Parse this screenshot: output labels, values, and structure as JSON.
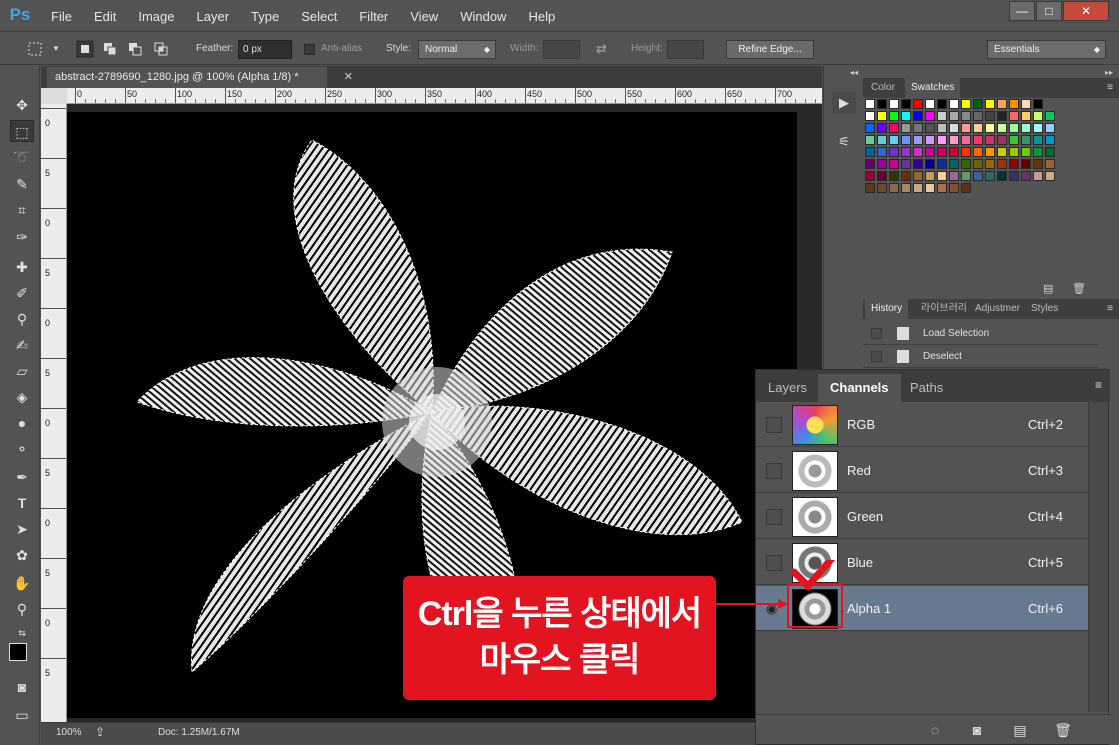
{
  "app": {
    "logo": "Ps"
  },
  "menu": [
    "File",
    "Edit",
    "Image",
    "Layer",
    "Type",
    "Select",
    "Filter",
    "View",
    "Window",
    "Help"
  ],
  "window_controls": {
    "minimize": "—",
    "maximize": "□",
    "close": "✕"
  },
  "options": {
    "feather_label": "Feather:",
    "feather_value": "0 px",
    "antialias_label": "Anti-alias",
    "style_label": "Style:",
    "style_value": "Normal",
    "width_label": "Width:",
    "height_label": "Height:",
    "refine_button": "Refine Edge...",
    "workspace_value": "Essentials"
  },
  "document": {
    "tab_title": "abstract-2789690_1280.jpg @ 100% (Alpha 1/8) *",
    "close_glyph": "✕",
    "ruler_top_labels": [
      "0",
      "50",
      "100",
      "150",
      "200",
      "250",
      "300",
      "350",
      "400",
      "450",
      "500",
      "550",
      "600",
      "650",
      "700"
    ],
    "ruler_left_labels": [
      "0",
      "5",
      "0",
      "5",
      "0",
      "5",
      "0",
      "5",
      "0",
      "5",
      "0",
      "5"
    ],
    "zoom": "100%",
    "doc_info": "Doc: 1.25M/1.67M"
  },
  "swatches_panel": {
    "tabs": [
      "Color",
      "Swatches"
    ],
    "active_tab": "Swatches",
    "menu_glyph": "≡",
    "rows": [
      [
        "#ffffff",
        "#000000",
        "#ffffff",
        "#000000",
        "#ff0000",
        "#ffffff",
        "#000000",
        "#ffffff",
        "#ffff00",
        "#006400",
        "#ffff00",
        "#f4a460",
        "#ff8c00",
        "#f5deb3",
        "#000000"
      ],
      [
        "#ffffff",
        "#ffff00",
        "#00ff00",
        "#00ffff",
        "#0000ff",
        "#ff00ff",
        "#cccccc",
        "#aaaaaa",
        "#888888",
        "#666666",
        "#444444",
        "#222222",
        "#ff6666",
        "#ffcc66",
        "#ccff66",
        "#00cc66"
      ],
      [
        "#0066ff",
        "#6600ff",
        "#ff0066",
        "#999999",
        "#777777",
        "#555555",
        "#bbbbbb",
        "#dddddd",
        "#ff9999",
        "#ffcc99",
        "#ffff99",
        "#ccff99",
        "#99ff99",
        "#99ffcc",
        "#99ffff",
        "#99ccff"
      ],
      [
        "#66cc99",
        "#66cccc",
        "#66ccff",
        "#6699ff",
        "#9999ff",
        "#cc99ff",
        "#ff99ff",
        "#ff99cc",
        "#ff6699",
        "#ff3366",
        "#cc3366",
        "#993366",
        "#33cc33",
        "#339966",
        "#009999",
        "#0099cc"
      ],
      [
        "#006699",
        "#3366cc",
        "#6633cc",
        "#9933cc",
        "#cc33cc",
        "#cc0099",
        "#cc0066",
        "#cc0033",
        "#ff3300",
        "#ff6600",
        "#ff9900",
        "#cccc00",
        "#99cc00",
        "#66cc00",
        "#009933",
        "#006633"
      ],
      [
        "#660066",
        "#990099",
        "#cc0099",
        "#663399",
        "#330099",
        "#000099",
        "#003399",
        "#006666",
        "#336600",
        "#666600",
        "#996600",
        "#993300",
        "#990000",
        "#660000",
        "#663300",
        "#996633"
      ],
      [
        "#990033",
        "#660033",
        "#333300",
        "#663300",
        "#996633",
        "#cc9966",
        "#ffcc99",
        "#996699",
        "#669966",
        "#336699",
        "#336666",
        "#003333",
        "#333366",
        "#663366",
        "#cc9999",
        "#ccaa88"
      ],
      [
        "#5a3a1a",
        "#6b4a2a",
        "#8b6a4a",
        "#aa8866",
        "#c8a882",
        "#e8c8a2",
        "#b07040",
        "#805030",
        "#603010"
      ]
    ]
  },
  "history_panel": {
    "tabs": [
      "History",
      "라이브러리",
      "Adjustmer",
      "Styles"
    ],
    "active_tab": "History",
    "menu_glyph": "≡",
    "items": [
      "Load Selection",
      "Deselect"
    ]
  },
  "channels_panel": {
    "tabs": [
      "Layers",
      "Channels",
      "Paths"
    ],
    "active_tab": "Channels",
    "menu_glyph": "≡",
    "rows": [
      {
        "name": "RGB",
        "shortcut": "Ctrl+2",
        "selected": false
      },
      {
        "name": "Red",
        "shortcut": "Ctrl+3",
        "selected": false
      },
      {
        "name": "Green",
        "shortcut": "Ctrl+4",
        "selected": false
      },
      {
        "name": "Blue",
        "shortcut": "Ctrl+5",
        "selected": false
      },
      {
        "name": "Alpha 1",
        "shortcut": "Ctrl+6",
        "selected": true
      }
    ]
  },
  "annotation": {
    "line1": "Ctrl을 누른 상태에서",
    "line2": "마우스 클릭",
    "color": "#e2141f"
  }
}
